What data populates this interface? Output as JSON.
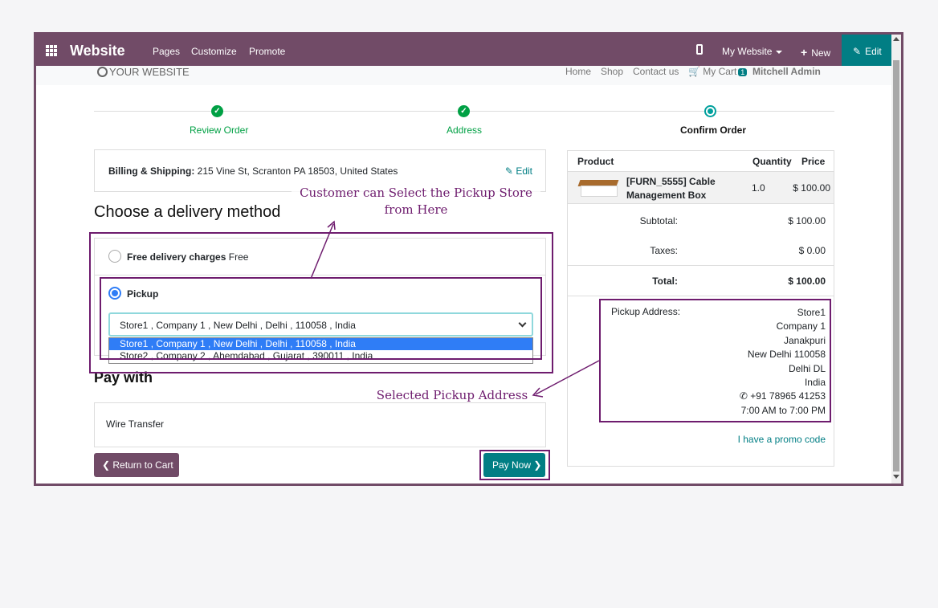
{
  "topbar": {
    "brand": "Website",
    "menu": [
      "Pages",
      "Customize",
      "Promote"
    ],
    "website_selector": "My Website",
    "new_label": "New",
    "edit_label": "Edit"
  },
  "site_header": {
    "logo": "YOUR WEBSITE",
    "nav": [
      "Home",
      "Shop",
      "Contact us"
    ],
    "cart_label": "My Cart",
    "cart_count": "1",
    "user": "Mitchell Admin"
  },
  "steps": [
    {
      "label": "Review Order",
      "state": "done"
    },
    {
      "label": "Address",
      "state": "done"
    },
    {
      "label": "Confirm Order",
      "state": "current"
    }
  ],
  "billing": {
    "label": "Billing & Shipping:",
    "address": "215 Vine St, Scranton PA 18503, United States",
    "edit_label": "Edit"
  },
  "delivery": {
    "heading": "Choose a delivery method",
    "options": [
      {
        "name": "Free delivery charges",
        "price": "Free",
        "checked": false
      },
      {
        "name": "Pickup",
        "price": "",
        "checked": true
      }
    ],
    "store_select_value": "Store1 , Company 1 , New Delhi , Delhi , 110058 , India",
    "store_options": [
      "Store1 , Company 1 , New Delhi , Delhi , 110058 , India",
      "Store2 , Company 2 , Ahemdabad , Gujarat , 390011 , India"
    ]
  },
  "payment": {
    "heading": "Pay with",
    "method": "Wire Transfer",
    "back_label": "Return to Cart",
    "pay_label": "Pay Now"
  },
  "summary": {
    "headers": [
      "Product",
      "Quantity",
      "Price"
    ],
    "product": {
      "name_line1": "[FURN_5555] Cable",
      "name_line2": "Management Box",
      "quantity": "1.0",
      "price": "$ 100.00"
    },
    "subtotal_label": "Subtotal:",
    "subtotal": "$ 100.00",
    "taxes_label": "Taxes:",
    "taxes": "$ 0.00",
    "total_label": "Total:",
    "total": "$ 100.00",
    "pickup_label": "Pickup Address:",
    "pickup_address": [
      "Store1",
      "Company 1",
      "Janakpuri",
      "New Delhi 110058",
      "Delhi DL",
      "India",
      "+91 78965 41253",
      "7:00 AM to 7:00 PM"
    ],
    "promo_label": "I have a promo code"
  },
  "annotations": {
    "select_store_line1": "Customer can Select the Pickup Store",
    "select_store_line2": "from Here",
    "selected_address": "Selected Pickup Address",
    "color": "#6e1c6e"
  },
  "colors": {
    "primary": "#714b67",
    "accent": "#017e84",
    "success": "#00a044"
  }
}
